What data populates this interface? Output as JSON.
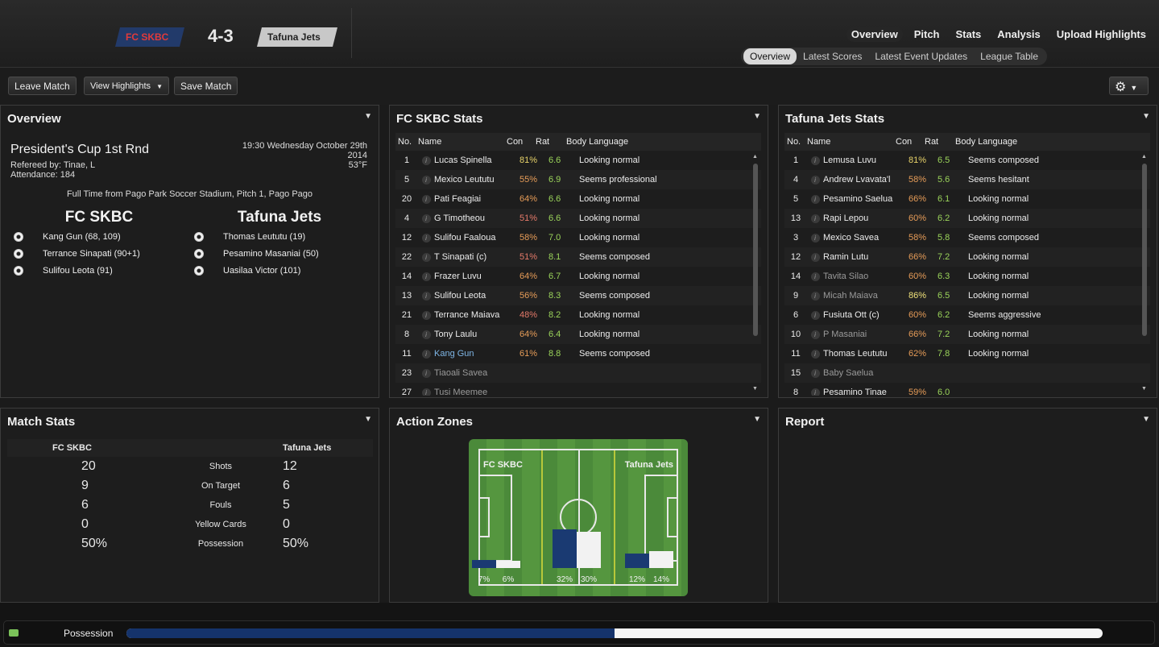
{
  "header": {
    "home_team": "FC SKBC",
    "away_team": "Tafuna Jets",
    "score": "4-3",
    "nav": [
      "Overview",
      "Pitch",
      "Stats",
      "Analysis",
      "Upload Highlights"
    ],
    "subnav": [
      "Overview",
      "Latest Scores",
      "Latest Event Updates",
      "League Table"
    ],
    "active_nav": "Overview",
    "active_subnav": "Overview"
  },
  "toolbar": {
    "leave": "Leave Match",
    "highlights": "View Highlights",
    "save": "Save Match"
  },
  "overview": {
    "title": "Overview",
    "competition": "President's Cup 1st Rnd",
    "referee": "Refereed by: Tinae, L",
    "attendance": "Attendance: 184",
    "datetime": "19:30 Wednesday October 29th 2014",
    "temperature": "53°F",
    "venue": "Full Time from Pago Park Soccer Stadium, Pitch 1, Pago Pago",
    "home_team": "FC SKBC",
    "away_team": "Tafuna Jets",
    "home_scorers": [
      "Kang Gun (68, 109)",
      "Terrance Sinapati (90+1)",
      "Sulifou Leota (91)"
    ],
    "away_scorers": [
      "Thomas Leututu (19)",
      "Pesamino Masaniai (50)",
      "Uasilaa Victor (101)"
    ]
  },
  "table_headers": {
    "no": "No.",
    "name": "Name",
    "con": "Con",
    "rat": "Rat",
    "body": "Body Language"
  },
  "home_stats": {
    "title": "FC SKBC Stats",
    "players": [
      {
        "no": "1",
        "name": "Lucas Spinella",
        "con": "81%",
        "rat": "6.6",
        "body": "Looking normal",
        "con_class": "con-good"
      },
      {
        "no": "5",
        "name": "Mexico Leututu",
        "con": "55%",
        "rat": "6.9",
        "body": "Seems professional",
        "con_class": "con-mid"
      },
      {
        "no": "20",
        "name": "Pati Feagiai",
        "con": "64%",
        "rat": "6.6",
        "body": "Looking normal",
        "con_class": "con-mid"
      },
      {
        "no": "4",
        "name": "G Timotheou",
        "con": "51%",
        "rat": "6.6",
        "body": "Looking normal",
        "con_class": "con-low"
      },
      {
        "no": "12",
        "name": "Sulifou Faaloua",
        "con": "58%",
        "rat": "7.0",
        "body": "Looking normal",
        "con_class": "con-mid"
      },
      {
        "no": "22",
        "name": "T Sinapati (c)",
        "con": "51%",
        "rat": "8.1",
        "body": "Seems composed",
        "con_class": "con-low"
      },
      {
        "no": "14",
        "name": "Frazer Luvu",
        "con": "64%",
        "rat": "6.7",
        "body": "Looking normal",
        "con_class": "con-mid"
      },
      {
        "no": "13",
        "name": "Sulifou Leota",
        "con": "56%",
        "rat": "8.3",
        "body": "Seems composed",
        "con_class": "con-mid"
      },
      {
        "no": "21",
        "name": "Terrance Maiava",
        "con": "48%",
        "rat": "8.2",
        "body": "Looking normal",
        "con_class": "con-low"
      },
      {
        "no": "8",
        "name": "Tony Laulu",
        "con": "64%",
        "rat": "6.4",
        "body": "Looking normal",
        "con_class": "con-mid"
      },
      {
        "no": "11",
        "name": "Kang Gun",
        "con": "61%",
        "rat": "8.8",
        "body": "Seems composed",
        "con_class": "con-mid",
        "name_class": "highlight-player"
      },
      {
        "no": "23",
        "name": "Tiaoali Savea",
        "con": "",
        "rat": "",
        "body": "",
        "con_class": "",
        "name_class": "sub-player"
      },
      {
        "no": "27",
        "name": "Tusi Meemee",
        "con": "",
        "rat": "",
        "body": "",
        "con_class": "",
        "name_class": "sub-player"
      }
    ]
  },
  "away_stats": {
    "title": "Tafuna Jets Stats",
    "players": [
      {
        "no": "1",
        "name": "Lemusa Luvu",
        "con": "81%",
        "rat": "6.5",
        "body": "Seems composed",
        "con_class": "con-good"
      },
      {
        "no": "4",
        "name": "Andrew Lvavata'l",
        "con": "58%",
        "rat": "5.6",
        "body": "Seems hesitant",
        "con_class": "con-mid"
      },
      {
        "no": "5",
        "name": "Pesamino Saelua",
        "con": "66%",
        "rat": "6.1",
        "body": "Looking normal",
        "con_class": "con-mid"
      },
      {
        "no": "13",
        "name": "Rapi Lepou",
        "con": "60%",
        "rat": "6.2",
        "body": "Looking normal",
        "con_class": "con-mid"
      },
      {
        "no": "3",
        "name": "Mexico Savea",
        "con": "58%",
        "rat": "5.8",
        "body": "Seems composed",
        "con_class": "con-mid"
      },
      {
        "no": "12",
        "name": "Ramin Lutu",
        "con": "66%",
        "rat": "7.2",
        "body": "Looking normal",
        "con_class": "con-mid"
      },
      {
        "no": "14",
        "name": "Tavita Silao",
        "con": "60%",
        "rat": "6.3",
        "body": "Looking normal",
        "con_class": "con-mid",
        "name_class": "sub-player"
      },
      {
        "no": "9",
        "name": "Micah Maiava",
        "con": "86%",
        "rat": "6.5",
        "body": "Looking normal",
        "con_class": "con-high",
        "name_class": "sub-player"
      },
      {
        "no": "6",
        "name": "Fusiuta Ott (c)",
        "con": "60%",
        "rat": "6.2",
        "body": "Seems aggressive",
        "con_class": "con-mid"
      },
      {
        "no": "10",
        "name": "P Masaniai",
        "con": "66%",
        "rat": "7.2",
        "body": "Looking normal",
        "con_class": "con-mid",
        "name_class": "sub-player"
      },
      {
        "no": "11",
        "name": "Thomas Leututu",
        "con": "62%",
        "rat": "7.8",
        "body": "Looking normal",
        "con_class": "con-mid"
      },
      {
        "no": "15",
        "name": "Baby Saelua",
        "con": "",
        "rat": "",
        "body": "",
        "con_class": "",
        "name_class": "sub-player"
      },
      {
        "no": "8",
        "name": "Pesamino Tinae",
        "con": "59%",
        "rat": "6.0",
        "body": "",
        "con_class": "con-mid"
      }
    ]
  },
  "match_stats": {
    "title": "Match Stats",
    "home": "FC SKBC",
    "away": "Tafuna Jets",
    "rows": [
      {
        "label": "Shots",
        "home": "20",
        "away": "12"
      },
      {
        "label": "On Target",
        "home": "9",
        "away": "6"
      },
      {
        "label": "Fouls",
        "home": "6",
        "away": "5"
      },
      {
        "label": "Yellow Cards",
        "home": "0",
        "away": "0"
      },
      {
        "label": "Possession",
        "home": "50%",
        "away": "50%"
      }
    ]
  },
  "action_zones": {
    "title": "Action Zones",
    "home": "FC SKBC",
    "away": "Tafuna Jets",
    "zones": [
      {
        "home": 7,
        "away": 6
      },
      {
        "home": 32,
        "away": 30
      },
      {
        "home": 12,
        "away": 14
      }
    ]
  },
  "report": {
    "title": "Report"
  },
  "possession_bar": {
    "label": "Possession",
    "home_fraction": 0.5
  },
  "colors": {
    "home": "#1a3a72",
    "away": "#f2f2f2",
    "rating": "#9bd45a"
  }
}
